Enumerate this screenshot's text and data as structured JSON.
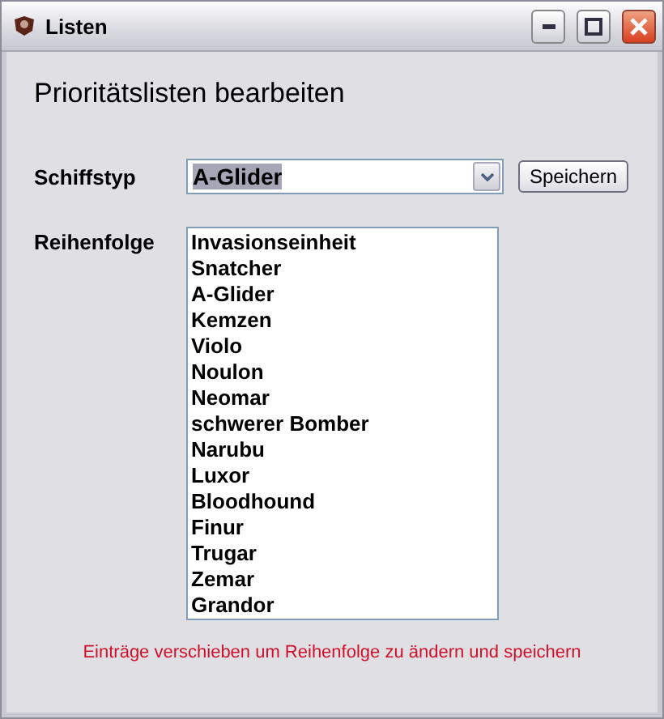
{
  "window": {
    "title": "Listen"
  },
  "heading": "Prioritätslisten bearbeiten",
  "ship_type": {
    "label": "Schiffstyp",
    "value": "A-Glider"
  },
  "save_button": "Speichern",
  "order": {
    "label": "Reihenfolge",
    "items": [
      "Invasionseinheit",
      "Snatcher",
      "A-Glider",
      "Kemzen",
      "Violo",
      "Noulon",
      "Neomar",
      "schwerer Bomber",
      "Narubu",
      "Luxor",
      "Bloodhound",
      "Finur",
      "Trugar",
      "Zemar",
      "Grandor"
    ]
  },
  "hint": "Einträge verschieben um Reihenfolge zu ändern und speichern"
}
